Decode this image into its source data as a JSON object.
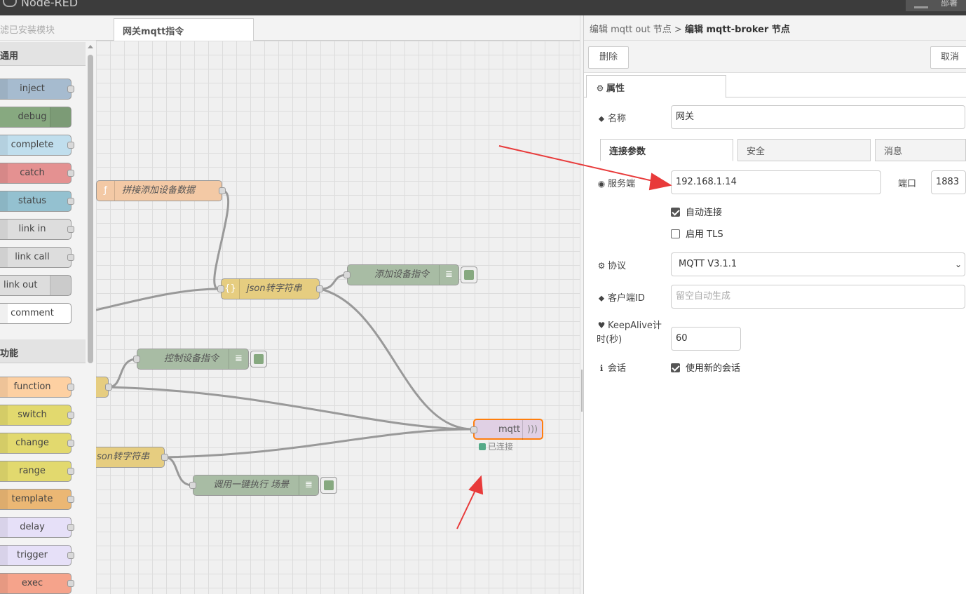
{
  "app": {
    "title": "Node-RED",
    "deploy_label": "部署"
  },
  "palette": {
    "search_text": "滤已安装模块",
    "categories": [
      {
        "label": "通用",
        "items": [
          "inject",
          "debug",
          "complete",
          "catch",
          "status",
          "link in",
          "link call",
          "link out",
          "comment"
        ]
      },
      {
        "label": "功能",
        "items": [
          "function",
          "switch",
          "change",
          "range",
          "template",
          "delay",
          "trigger",
          "exec"
        ]
      }
    ],
    "colors": {
      "inject": "#a6bbcf",
      "debug": "#87a980",
      "complete": "#c0deed",
      "catch": "#e49191",
      "status": "#94c1d0",
      "link": "#dddddd",
      "comment": "#ffffff",
      "function": "#fdd0a2",
      "switch": "#e2d96e",
      "change": "#e2d96e",
      "range": "#e2d96e",
      "template": "#ebb774",
      "delay": "#e6e0f8",
      "trigger": "#e6e0f8",
      "exec": "#f5a38b"
    }
  },
  "workspace": {
    "tab_label": "网关mqtt指令",
    "nodes": [
      {
        "label": "拼接添加设备数据",
        "type": "function"
      },
      {
        "label": "json转字符串",
        "type": "json"
      },
      {
        "label": "添加设备指令",
        "type": "debug"
      },
      {
        "label": "控制设备指令",
        "type": "debug"
      },
      {
        "label": "mqtt",
        "type": "mqtt-out"
      },
      {
        "label": "son转字符串",
        "type": "json"
      },
      {
        "label": "调用一键执行 场景",
        "type": "debug"
      }
    ],
    "mqtt_status": "已连接"
  },
  "editor": {
    "breadcrumb_prefix": "编辑 mqtt out 节点 >",
    "breadcrumb_current": "编辑 mqtt-broker 节点",
    "delete_label": "删除",
    "cancel_label": "取消",
    "properties_tab": "属性",
    "name_label": "名称",
    "name_value": "网关",
    "subtabs": [
      "连接参数",
      "安全",
      "消息"
    ],
    "server_label": "服务端",
    "server_value": "192.168.1.14",
    "port_label": "端口",
    "port_value": "1883",
    "auto_connect_label": "自动连接",
    "auto_connect_checked": true,
    "tls_label": "启用 TLS",
    "tls_checked": false,
    "protocol_label": "协议",
    "protocol_value": "MQTT V3.1.1",
    "client_id_label": "客户端ID",
    "client_id_placeholder": "留空自动生成",
    "keepalive_label": "KeepAlive计时(秒)",
    "keepalive_value": "60",
    "session_label": "会话",
    "session_option_label": "使用新的会话",
    "session_checked": true
  },
  "annotations": {
    "arrow_color": "#e83a3a"
  }
}
